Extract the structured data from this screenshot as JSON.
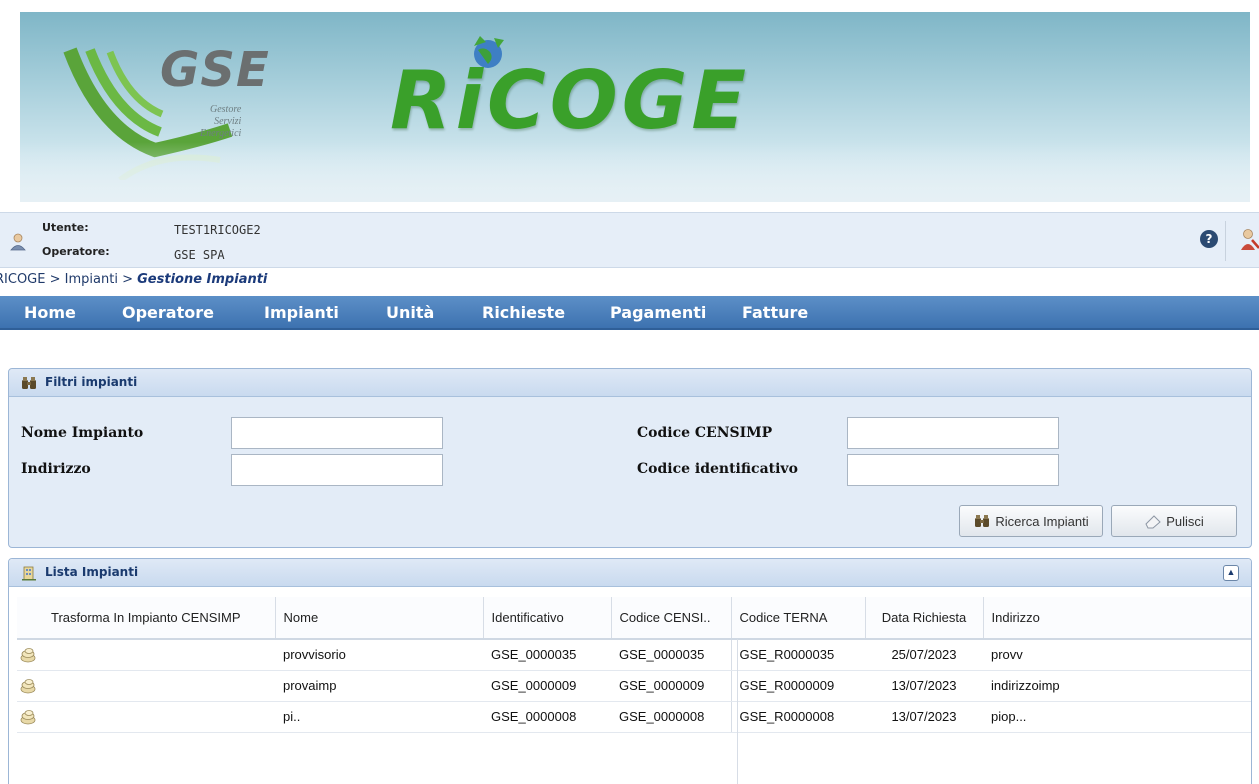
{
  "header": {
    "logo_text": "GSE",
    "logo_subtitle": [
      "Gestore",
      "Servizi",
      "Energetici"
    ],
    "app_title": "RiCOGE"
  },
  "user": {
    "user_label": "Utente:",
    "user_value": "TEST1RICOGE2",
    "operator_label": "Operatore:",
    "operator_value": "GSE SPA"
  },
  "breadcrumb": {
    "items": [
      "RICOGE",
      "Impianti",
      "Gestione Impianti"
    ],
    "separator": ">"
  },
  "nav": {
    "items": [
      "Home",
      "Operatore",
      "Impianti",
      "Unità",
      "Richieste",
      "Pagamenti",
      "Fatture"
    ]
  },
  "filters": {
    "title": "Filtri impianti",
    "nome_label": "Nome Impianto",
    "nome_value": "",
    "indirizzo_label": "Indirizzo",
    "indirizzo_value": "",
    "censimp_label": "Codice CENSIMP",
    "censimp_value": "",
    "identificativo_label": "Codice identificativo",
    "identificativo_value": "",
    "search_button": "Ricerca Impianti",
    "clear_button": "Pulisci"
  },
  "list": {
    "title": "Lista Impianti",
    "columns": [
      "Trasforma In Impianto CENSIMP",
      "Nome",
      "Identificativo",
      "Codice CENSI..",
      "Codice TERNA",
      "Data Richiesta",
      "Indirizzo"
    ],
    "rows": [
      {
        "nome": "provvisorio",
        "identificativo": "GSE_0000035",
        "censimp": "GSE_0000035",
        "terna": "GSE_R0000035",
        "data": "25/07/2023",
        "indirizzo": "provv"
      },
      {
        "nome": "provaimp",
        "identificativo": "GSE_0000009",
        "censimp": "GSE_0000009",
        "terna": "GSE_R0000009",
        "data": "13/07/2023",
        "indirizzo": "indirizzoimp"
      },
      {
        "nome": "pi..",
        "identificativo": "GSE_0000008",
        "censimp": "GSE_0000008",
        "terna": "GSE_R0000008",
        "data": "13/07/2023",
        "indirizzo": "piop..."
      }
    ]
  },
  "colors": {
    "nav_bg": "#3d72b0",
    "title_green": "#3aa02a",
    "panel_bg": "#e3ecf7",
    "panel_title": "#1a3a6e"
  },
  "icons": {
    "user": "user-icon",
    "help": "help-icon",
    "logout": "logout-icon",
    "filter": "binoculars-icon",
    "list": "building-icon",
    "row": "transform-icon",
    "collapse": "collapse-icon",
    "clear": "eraser-icon"
  }
}
